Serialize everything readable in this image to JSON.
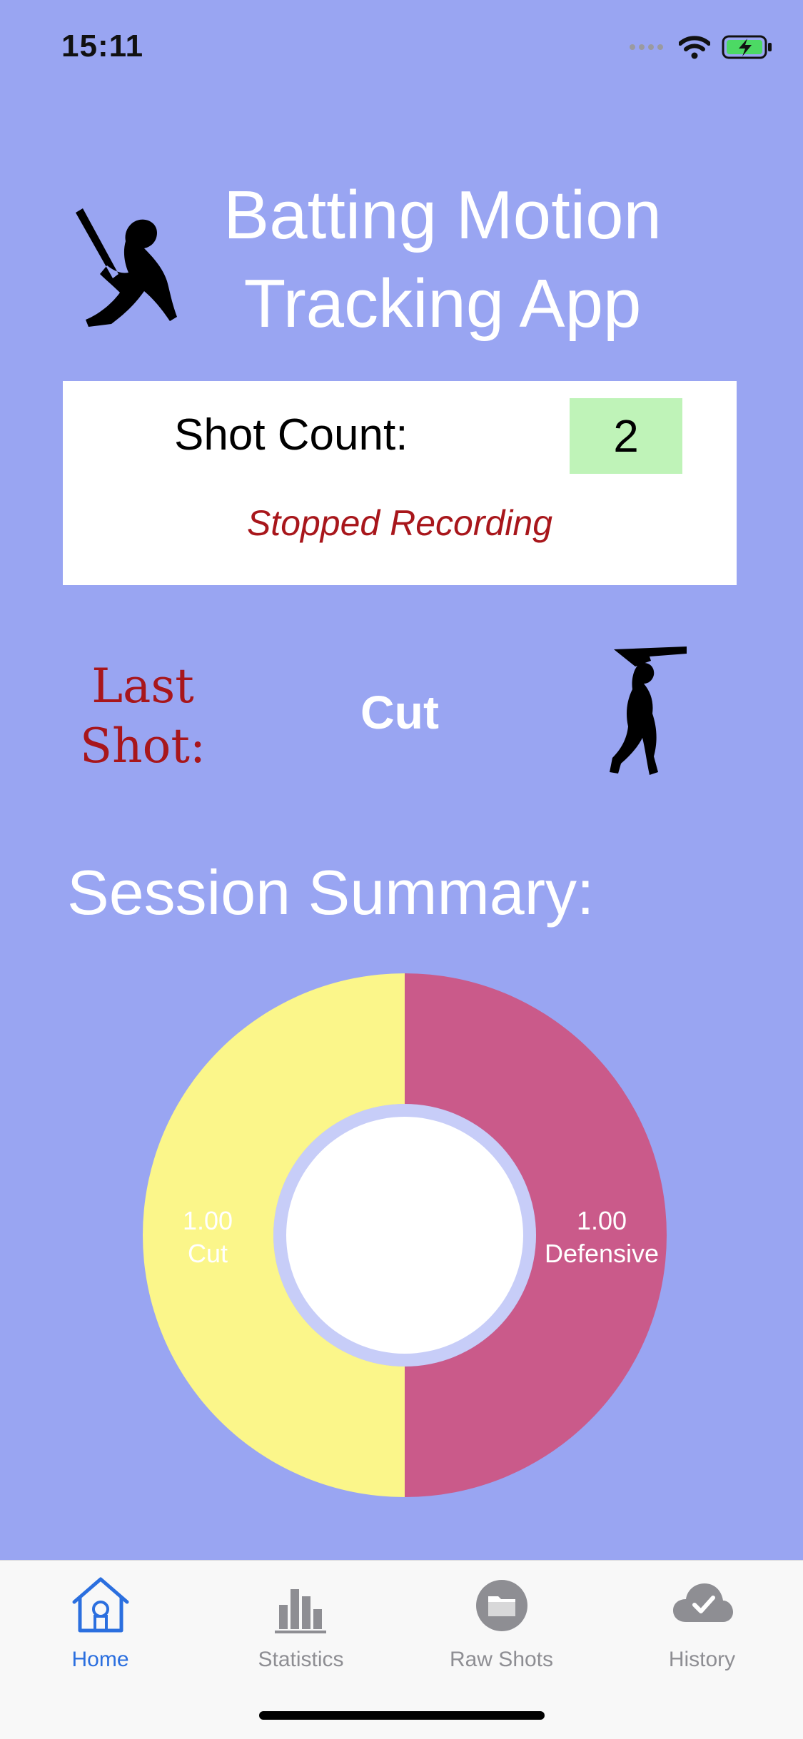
{
  "status_bar": {
    "time": "15:11"
  },
  "header": {
    "title_line1": "Batting Motion",
    "title_line2": "Tracking App",
    "logo_icon": "cricket-batter-silhouette-icon"
  },
  "shot_card": {
    "label": "Shot Count:",
    "count": "2",
    "status": "Stopped Recording"
  },
  "last_shot": {
    "label_line1": "Last",
    "label_line2": "Shot:",
    "value": "Cut",
    "icon": "cricket-batter-cut-icon"
  },
  "summary": {
    "title": "Session Summary:"
  },
  "chart_data": {
    "type": "pie",
    "donut": true,
    "categories": [
      "Cut",
      "Defensive"
    ],
    "values": [
      1.0,
      1.0
    ],
    "value_labels": [
      "1.00",
      "1.00"
    ],
    "colors": [
      "#fbf68a",
      "#ca5a8a"
    ]
  },
  "tabs": [
    {
      "label": "Home",
      "icon": "home-icon",
      "active": true
    },
    {
      "label": "Statistics",
      "icon": "bar-chart-icon",
      "active": false
    },
    {
      "label": "Raw Shots",
      "icon": "folder-icon",
      "active": false
    },
    {
      "label": "History",
      "icon": "cloud-check-icon",
      "active": false
    }
  ],
  "colors": {
    "background": "#99a5f2",
    "accent_red": "#a8161b",
    "active_tab": "#2b6fdf",
    "count_box": "#bff3b8"
  }
}
